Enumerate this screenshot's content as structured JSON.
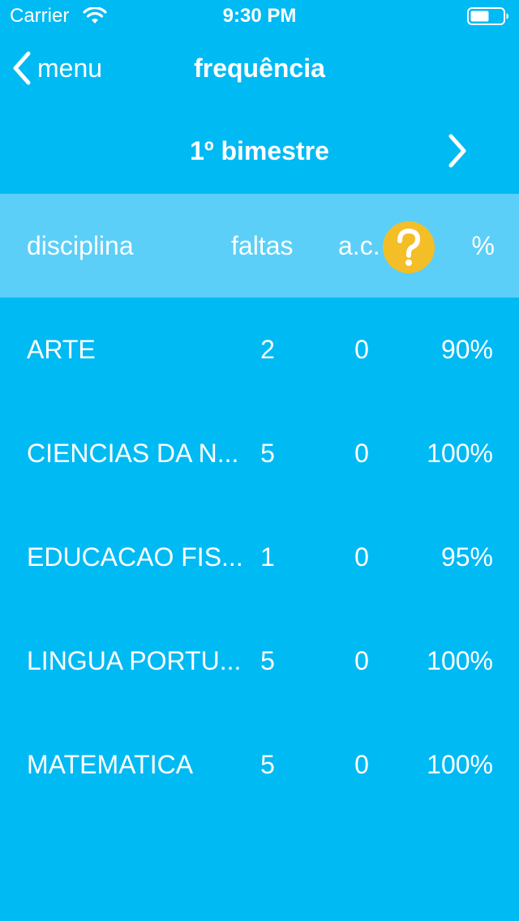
{
  "status_bar": {
    "carrier": "Carrier",
    "time": "9:30 PM",
    "wifi_icon": "wifi-icon",
    "battery_icon": "battery-icon"
  },
  "nav": {
    "back_label": "menu",
    "back_icon": "chevron-left-icon",
    "title": "frequência"
  },
  "period": {
    "title": "1º bimestre",
    "next_icon": "chevron-right-icon"
  },
  "table": {
    "headers": {
      "disciplina": "disciplina",
      "faltas": "faltas",
      "ac": "a.c.",
      "pct": "%"
    },
    "help_icon": "question-mark-icon",
    "rows": [
      {
        "disciplina": "ARTE",
        "faltas": "2",
        "ac": "0",
        "pct": "90%"
      },
      {
        "disciplina": "CIENCIAS DA N...",
        "faltas": "5",
        "ac": "0",
        "pct": "100%"
      },
      {
        "disciplina": "EDUCACAO FIS...",
        "faltas": "1",
        "ac": "0",
        "pct": "95%"
      },
      {
        "disciplina": "LINGUA PORTU...",
        "faltas": "5",
        "ac": "0",
        "pct": "100%"
      },
      {
        "disciplina": "MATEMATICA",
        "faltas": "5",
        "ac": "0",
        "pct": "100%"
      }
    ]
  },
  "colors": {
    "background": "#00BAF4",
    "header_background": "#5BCFF8",
    "help_accent": "#F4BE27",
    "text": "#FFFFFF"
  }
}
